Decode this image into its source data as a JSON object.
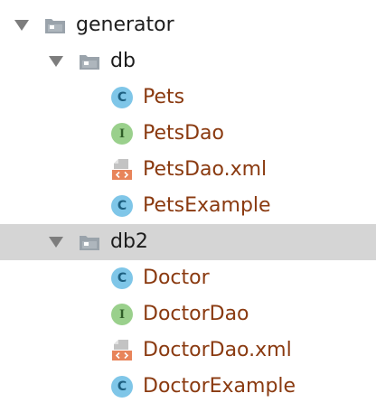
{
  "tree": {
    "items": [
      {
        "label": "generator",
        "kind": "folder",
        "level": 0,
        "expanded": true,
        "selected": false,
        "icon": "folder-icon"
      },
      {
        "label": "db",
        "kind": "folder",
        "level": 1,
        "expanded": true,
        "selected": false,
        "icon": "folder-icon"
      },
      {
        "label": "Pets",
        "kind": "class",
        "level": 2,
        "selected": false,
        "icon": "class-icon"
      },
      {
        "label": "PetsDao",
        "kind": "interface",
        "level": 2,
        "selected": false,
        "icon": "interface-icon"
      },
      {
        "label": "PetsDao.xml",
        "kind": "xml",
        "level": 2,
        "selected": false,
        "icon": "xml-file-icon"
      },
      {
        "label": "PetsExample",
        "kind": "class",
        "level": 2,
        "selected": false,
        "icon": "class-icon"
      },
      {
        "label": "db2",
        "kind": "folder",
        "level": 1,
        "expanded": true,
        "selected": true,
        "icon": "folder-icon"
      },
      {
        "label": "Doctor",
        "kind": "class",
        "level": 2,
        "selected": false,
        "icon": "class-icon"
      },
      {
        "label": "DoctorDao",
        "kind": "interface",
        "level": 2,
        "selected": false,
        "icon": "interface-icon"
      },
      {
        "label": "DoctorDao.xml",
        "kind": "xml",
        "level": 2,
        "selected": false,
        "icon": "xml-file-icon"
      },
      {
        "label": "DoctorExample",
        "kind": "class",
        "level": 2,
        "selected": false,
        "icon": "class-icon"
      }
    ],
    "glyphs": {
      "class": "C",
      "interface": "I"
    },
    "colors": {
      "folder_label": "#1d1d1d",
      "file_label": "#8a3a10",
      "selection_bg": "#d5d5d5",
      "class_icon": "#7fc6e8",
      "interface_icon": "#9ad08c",
      "xml_icon": "#e8845a",
      "folder_icon": "#9aa3ab"
    }
  }
}
